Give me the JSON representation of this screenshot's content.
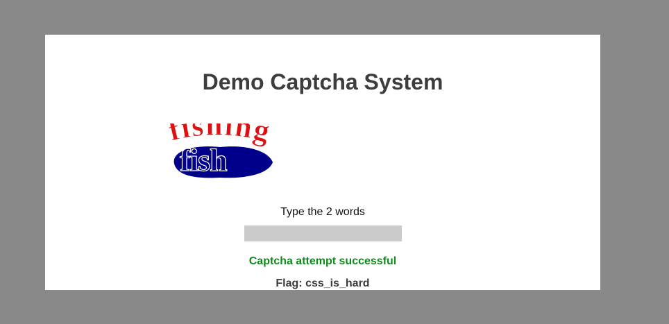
{
  "page": {
    "title": "Demo Captcha System"
  },
  "captcha": {
    "word_blue": "fish",
    "word_red": "fishing"
  },
  "form": {
    "prompt": "Type the 2 words",
    "answer_value": ""
  },
  "status": {
    "message": "Captcha attempt successful",
    "flag": "Flag: css_is_hard"
  },
  "colors": {
    "background": "#898989",
    "title": "#3d3d3d",
    "success": "#0f8a1c",
    "captcha_blue": "#00008b",
    "captcha_red": "#dd1111",
    "input_bg": "#cbcbcb"
  }
}
